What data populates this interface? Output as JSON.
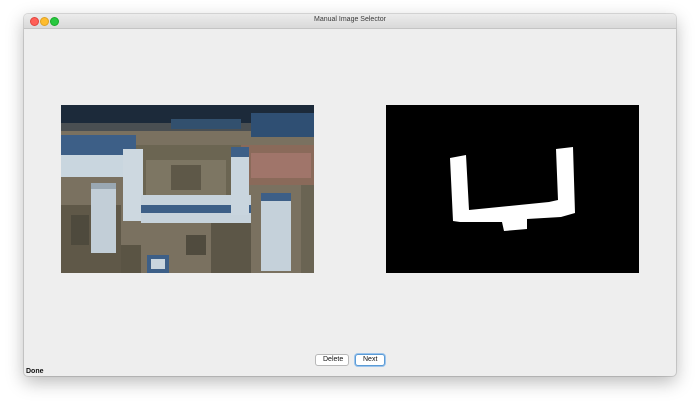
{
  "window": {
    "title": "Manual Image Selector"
  },
  "images": {
    "left": "aerial-building-photo",
    "right": "building-mask"
  },
  "buttons": {
    "delete_label": "Delete",
    "next_label": "Next"
  },
  "status": {
    "text": "Done"
  },
  "colors": {
    "window_bg": "#eeeeee",
    "mask_bg": "#000000",
    "mask_fg": "#ffffff",
    "focus_ring": "#5b9bd5"
  }
}
